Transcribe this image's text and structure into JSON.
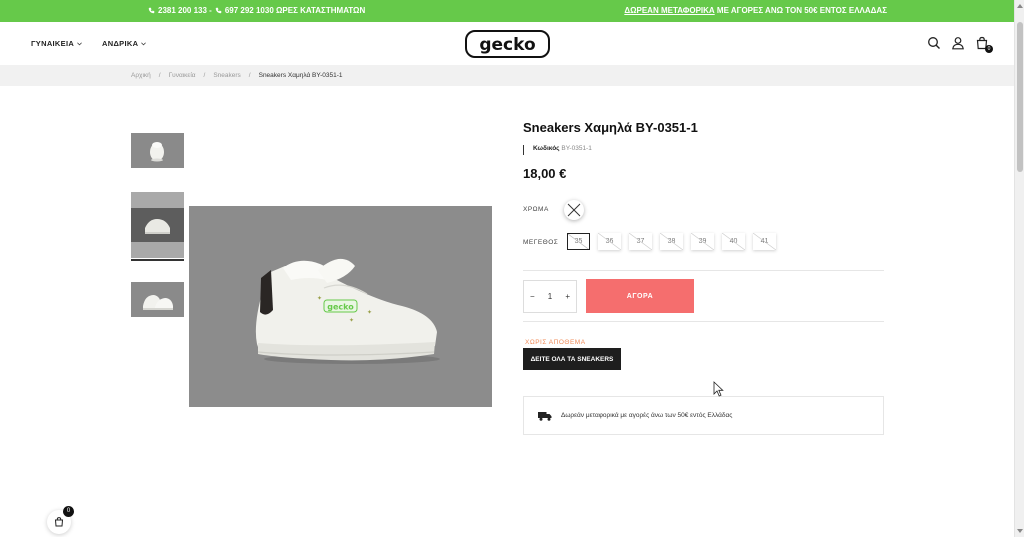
{
  "topbar": {
    "phone1": "2381 200 133 -",
    "phone2": "697 292 1030 ΩΡΕΣ ΚΑΤΑΣΤΗΜΑΤΩΝ",
    "promo_link": "ΔΩΡΕΑΝ ΜΕΤΑΦΟΡΙΚΑ",
    "promo_text": " ΜΕ ΑΓΟΡΕΣ ΑΝΩ ΤΟΝ 50€ ΕΝΤΟΣ ΕΛΛΑΔΑΣ",
    "color": "#66c94a"
  },
  "header": {
    "nav": [
      {
        "label": "ΓΥΝΑΙΚΕΙΑ"
      },
      {
        "label": "ΑΝΔΡΙΚΑ"
      }
    ],
    "logo_text": "gecko",
    "cart_count": "0"
  },
  "breadcrumb": [
    "Αρχική",
    "Γυναικεία",
    "Sneakers",
    "Sneakers Χαμηλά BY-0351-1"
  ],
  "product": {
    "title": "Sneakers Χαμηλά BY-0351-1",
    "sku_label": "Κωδικός",
    "sku_value": "BY-0351-1",
    "price": "18,00 €",
    "color_label": "ΧΡΩΜΑ",
    "size_label": "ΜΕΓΕΘΟΣ",
    "sizes": [
      "35",
      "36",
      "37",
      "38",
      "39",
      "40",
      "41"
    ],
    "selected_size": "35",
    "quantity": "1",
    "buy_label": "ΑΓΟΡΑ",
    "stock_status": "ΧΩΡΙΣ ΑΠΟΘΕΜΑ",
    "see_all_label": "ΔΕΙΤΕ ΟΛΑ ΤΑ SNEAKERS",
    "shipping_note": "Δωρεάν μεταφορικά με αγορές άνω των 50€ εντός Ελλάδας",
    "buy_color": "#f56e6e"
  },
  "floating_cart": {
    "count": "0"
  }
}
